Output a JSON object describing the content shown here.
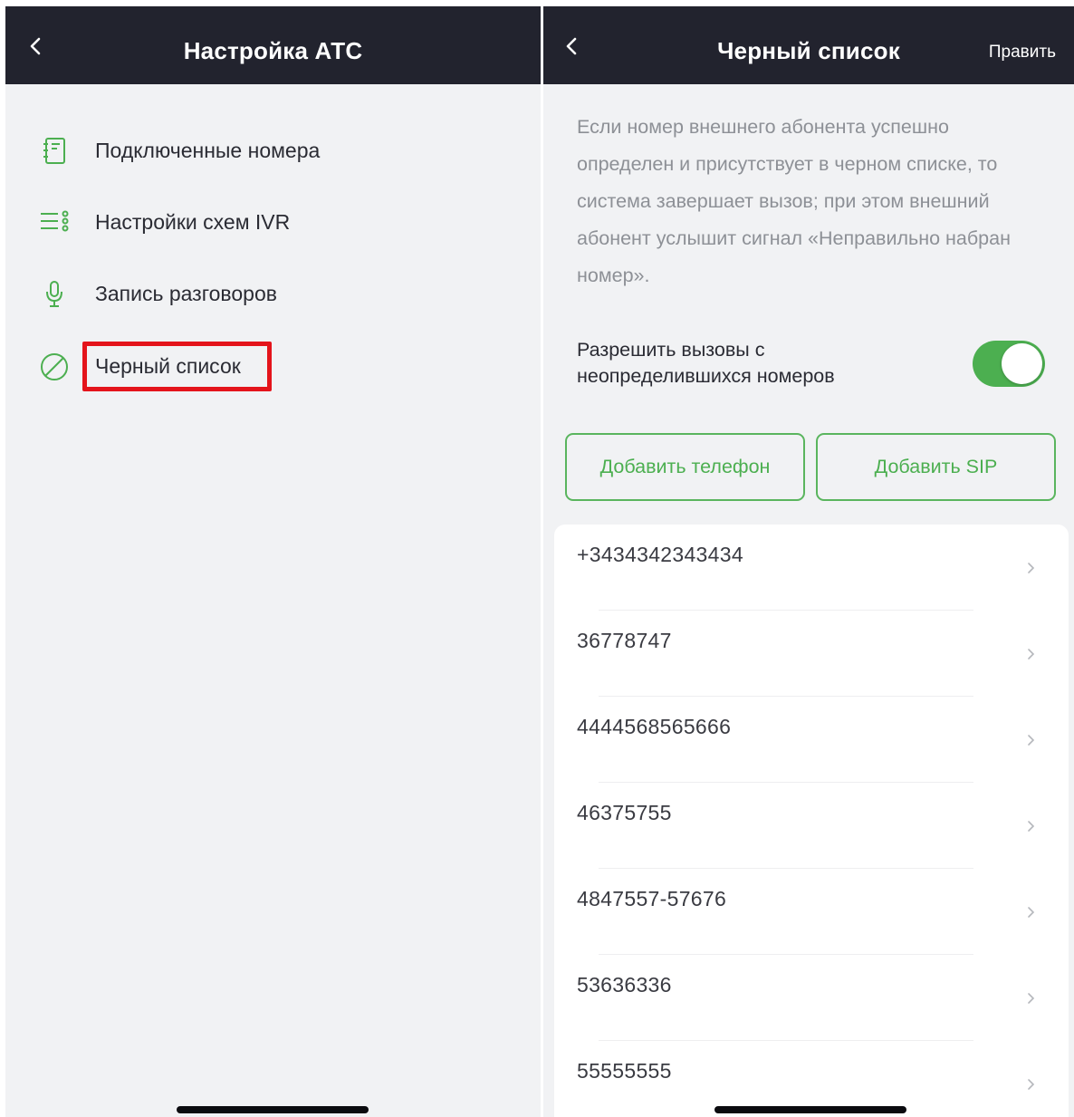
{
  "left_screen": {
    "title": "Настройка АТС",
    "menu_items": [
      {
        "label": "Подключенные номера",
        "icon": "notebook-icon"
      },
      {
        "label": "Настройки схем IVR",
        "icon": "list-settings-icon"
      },
      {
        "label": "Запись разговоров",
        "icon": "microphone-icon"
      },
      {
        "label": "Черный список",
        "icon": "block-icon"
      }
    ]
  },
  "right_screen": {
    "title": "Черный список",
    "edit_label": "Править",
    "description": "Если номер внешнего абонента успешно определен и присутствует в черном списке, то система завершает вызов; при этом внешний абонент услышит сигнал «Неправильно набран номер».",
    "toggle": {
      "label": "Разрешить вызовы с неопределившихся номеров",
      "on": true
    },
    "add_phone_label": "Добавить телефон",
    "add_sip_label": "Добавить SIP",
    "numbers": [
      "+3434342343434",
      "36778747",
      "4444568565666",
      "46375755",
      "4847557-57676",
      "53636336",
      "55555555"
    ]
  },
  "colors": {
    "navbar": "#22232e",
    "accent": "#4caf50",
    "highlight": "#e4141b",
    "background": "#f1f2f4"
  }
}
